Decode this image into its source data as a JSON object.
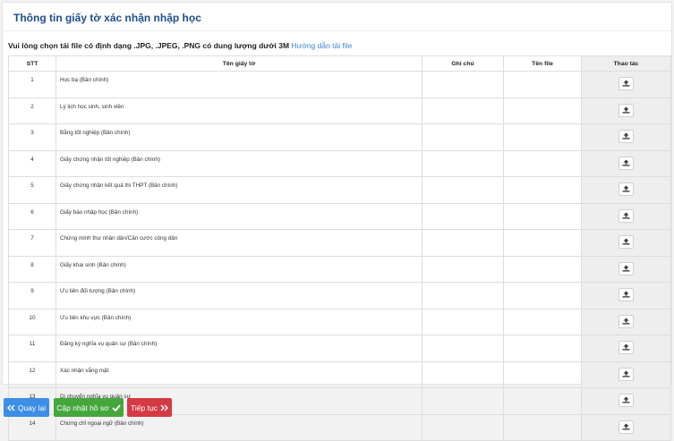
{
  "panel": {
    "title": "Thông tin giấy tờ xác nhận nhập học",
    "instruction_text": "Vui lòng chọn tải file có định dạng .JPG, .JPEG, .PNG có dung lượng dưới 3M",
    "instruction_link": "Hướng dẫn tải file"
  },
  "table": {
    "headers": [
      "STT",
      "Tên giấy tờ",
      "Ghi chú",
      "Tên file",
      "Thao tác"
    ],
    "rows": [
      {
        "stt": "1",
        "name": "Học bạ (Bản chính)",
        "note": "",
        "file": ""
      },
      {
        "stt": "2",
        "name": "Lý lịch học sinh, sinh viên",
        "note": "",
        "file": ""
      },
      {
        "stt": "3",
        "name": "Bằng tốt nghiệp (Bản chính)",
        "note": "",
        "file": ""
      },
      {
        "stt": "4",
        "name": "Giấy chứng nhận tốt nghiệp (Bản chính)",
        "note": "",
        "file": ""
      },
      {
        "stt": "5",
        "name": "Giấy chứng nhận kết quả thi THPT (Bản chính)",
        "note": "",
        "file": ""
      },
      {
        "stt": "6",
        "name": "Giấy báo nhập học (Bản chính)",
        "note": "",
        "file": ""
      },
      {
        "stt": "7",
        "name": "Chứng minh thư nhân dân/Căn cước công dân",
        "note": "",
        "file": ""
      },
      {
        "stt": "8",
        "name": "Giấy khai sinh (Bản chính)",
        "note": "",
        "file": ""
      },
      {
        "stt": "9",
        "name": "Ưu tiên đối tượng (Bản chính)",
        "note": "",
        "file": ""
      },
      {
        "stt": "10",
        "name": "Ưu tiên khu vực (Bản chính)",
        "note": "",
        "file": ""
      },
      {
        "stt": "11",
        "name": "Đăng ký nghĩa vụ quân sự (Bản chính)",
        "note": "",
        "file": ""
      },
      {
        "stt": "12",
        "name": "Xác nhận vắng mặt",
        "note": "",
        "file": ""
      },
      {
        "stt": "13",
        "name": "Di chuyển nghĩa vụ quân sự",
        "note": "",
        "file": ""
      },
      {
        "stt": "14",
        "name": "Chứng chỉ ngoại ngữ (Bản chính)",
        "note": "",
        "file": ""
      }
    ],
    "action_icon": "upload-icon"
  },
  "footer": {
    "back_label": "Quay lại",
    "update_label": "Cập nhật hồ sơ",
    "next_label": "Tiếp tục"
  },
  "colors": {
    "title": "#1f4e8c",
    "link": "#3a86d4",
    "back": "#3d8ee6",
    "update": "#45a63c",
    "next": "#d43a44"
  }
}
